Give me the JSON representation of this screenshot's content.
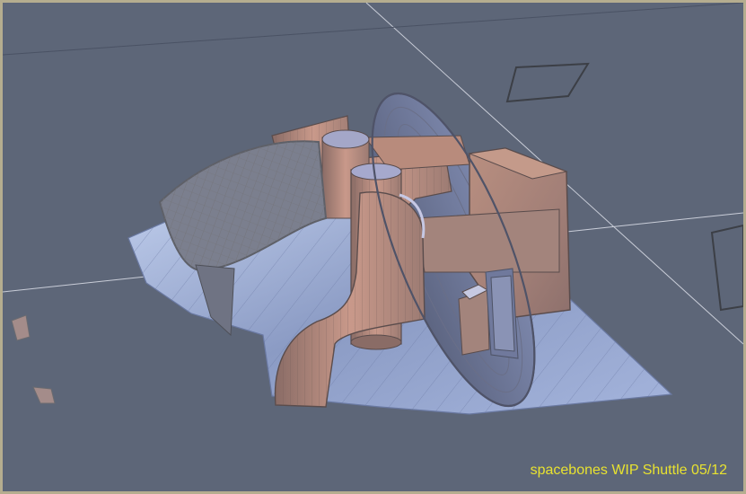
{
  "viewport": {
    "background": "#5d6678",
    "frame_color": "#b5ad8f",
    "caption": "spacebones WIP Shuttle 05/12",
    "caption_color": "#e8e230"
  },
  "model": {
    "hull_colors": [
      "#9c7b73",
      "#c29585",
      "#a58a86"
    ],
    "deck_colors": [
      "#8c9bc4",
      "#b7c6e8"
    ],
    "wire_color": "#6a6a6e"
  }
}
